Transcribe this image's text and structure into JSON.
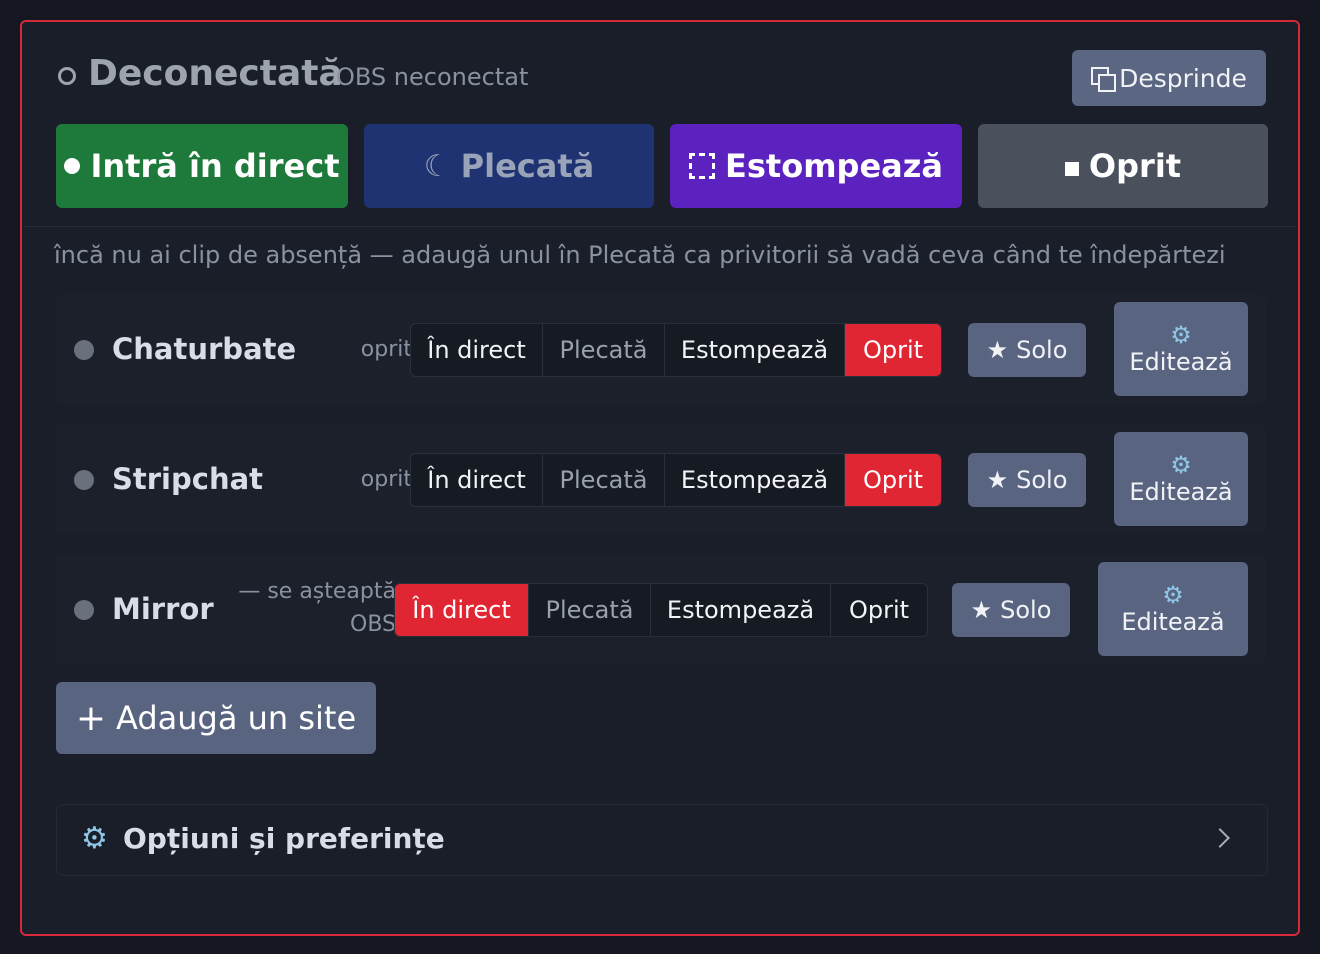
{
  "header": {
    "status_title": "Deconectată",
    "status_sub": "OBS neconectat",
    "detach_label": "Desprinde"
  },
  "big_buttons": {
    "live": "Intră în direct",
    "away": "Plecată",
    "blur": "Estompează",
    "stop": "Oprit"
  },
  "hint": "încă nu ai clip de absență — adaugă unul în Plecată ca privitorii să vadă ceva când te îndepărtezi",
  "sites": [
    {
      "name": "Chaturbate",
      "state": "oprit",
      "segments": [
        "În direct",
        "Plecată",
        "Estompează",
        "Oprit"
      ],
      "active": "Oprit",
      "solo": "Solo",
      "edit": "Editează"
    },
    {
      "name": "Stripchat",
      "state": "oprit",
      "segments": [
        "În direct",
        "Plecată",
        "Estompează",
        "Oprit"
      ],
      "active": "Oprit",
      "solo": "Solo",
      "edit": "Editează"
    },
    {
      "name": "Mirror",
      "state_line1": "— se așteaptă",
      "state_line2": "OBS",
      "segments": [
        "În direct",
        "Plecată",
        "Estompează",
        "Oprit"
      ],
      "active": "În direct",
      "solo": "Solo",
      "edit": "Editează"
    }
  ],
  "add_site_label": "Adaugă un site",
  "options_label": "Opțiuni și preferințe",
  "icons": {
    "status": "hollow-circle-icon",
    "detach": "detach-window-icon",
    "away": "moon-icon",
    "blur": "dashed-square-icon",
    "solo": "star-icon",
    "edit": "gear-icon",
    "add": "plus-icon",
    "options": "gear-icon",
    "options_expand": "chevron-right-icon"
  },
  "colors": {
    "panel_border": "#d42a3c",
    "live": "#1e7a3a",
    "away": "#1f3272",
    "blur": "#5c22c0",
    "stop": "#4a505c",
    "active_segment": "#e12633",
    "secondary_button": "#596480"
  }
}
